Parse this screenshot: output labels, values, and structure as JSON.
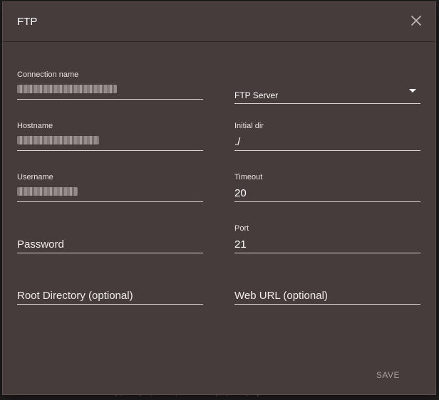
{
  "dialog": {
    "title": "FTP",
    "close_icon": "close-icon"
  },
  "fields": {
    "connection_name": {
      "label": "Connection name",
      "value": ""
    },
    "server_type": {
      "value": "FTP Server",
      "icon": "chevron-down-icon"
    },
    "hostname": {
      "label": "Hostname",
      "value": ""
    },
    "initial_dir": {
      "label": "Initial dir",
      "value": "./"
    },
    "username": {
      "label": "Username",
      "value": ""
    },
    "timeout": {
      "label": "Timeout",
      "value": "20"
    },
    "password": {
      "placeholder": "Password"
    },
    "port": {
      "label": "Port",
      "value": "21"
    },
    "root_directory": {
      "placeholder": "Root Directory (optional)"
    },
    "web_url": {
      "placeholder": "Web URL (optional)"
    }
  },
  "footer": {
    "save_label": "SAVE"
  },
  "background": {
    "code_line": "for ($i=0; $i < $counter; $i++) {"
  }
}
